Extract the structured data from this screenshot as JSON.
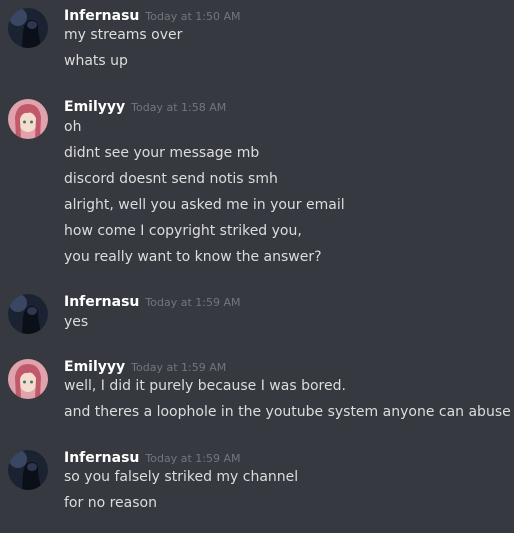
{
  "messages": [
    {
      "author": "Infernasu",
      "timestamp": "Today at 1:50 AM",
      "avatar": "dark-figure-avatar",
      "lines": [
        "my streams over",
        "whats up"
      ]
    },
    {
      "author": "Emilyyy",
      "timestamp": "Today at 1:58 AM",
      "avatar": "pink-hair-anime-avatar",
      "lines": [
        "oh",
        "didnt see your message mb",
        "discord doesnt send notis smh",
        "alright, well you asked me in your email",
        "how come I copyright striked you,",
        "you really want to know the answer?"
      ]
    },
    {
      "author": "Infernasu",
      "timestamp": "Today at 1:59 AM",
      "avatar": "dark-figure-avatar",
      "lines": [
        "yes"
      ]
    },
    {
      "author": "Emilyyy",
      "timestamp": "Today at 1:59 AM",
      "avatar": "pink-hair-anime-avatar",
      "lines": [
        "well, I did it purely because I was bored.",
        "and theres a loophole in the youtube system anyone can abuse"
      ]
    },
    {
      "author": "Infernasu",
      "timestamp": "Today at 1:59 AM",
      "avatar": "dark-figure-avatar",
      "lines": [
        "so you falsely striked my channel",
        "for no reason"
      ]
    }
  ],
  "colors": {
    "background": "#36393f",
    "author": "#ffffff",
    "timestamp": "#72767d",
    "text": "#dcddde"
  }
}
